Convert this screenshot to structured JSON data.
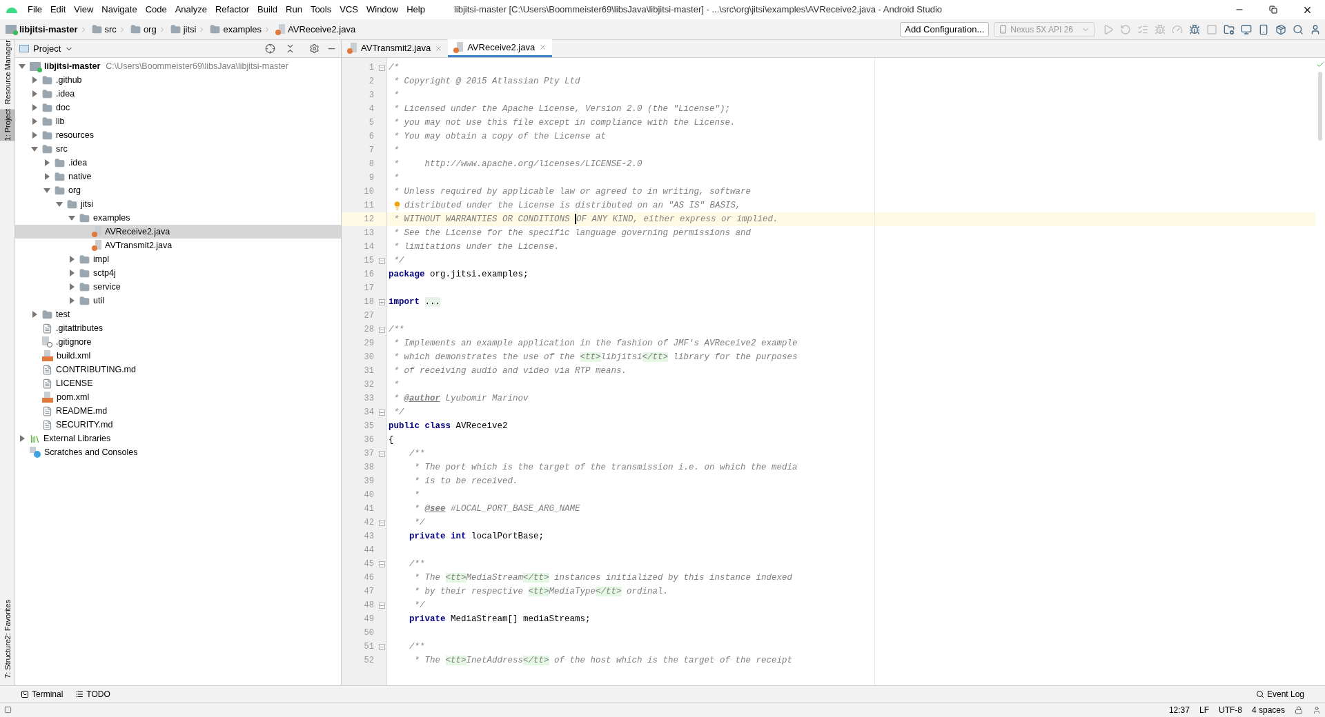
{
  "title_bar": {
    "menus": [
      "File",
      "Edit",
      "View",
      "Navigate",
      "Code",
      "Analyze",
      "Refactor",
      "Build",
      "Run",
      "Tools",
      "VCS",
      "Window",
      "Help"
    ],
    "title": "libjitsi-master [C:\\Users\\Boommeister69\\libsJava\\libjitsi-master] - ...\\src\\org\\jitsi\\examples\\AVReceive2.java - Android Studio"
  },
  "breadcrumbs": [
    {
      "label": "libjitsi-master",
      "kind": "module"
    },
    {
      "label": "src",
      "kind": "folder"
    },
    {
      "label": "org",
      "kind": "folder"
    },
    {
      "label": "jitsi",
      "kind": "folder"
    },
    {
      "label": "examples",
      "kind": "folder"
    },
    {
      "label": "AVReceive2.java",
      "kind": "java"
    }
  ],
  "toolbar": {
    "config_button": "Add Configuration...",
    "device": {
      "label": "Nexus 5X API 26",
      "disabled": true
    },
    "icons": [
      {
        "kind": "run",
        "disabled": true
      },
      {
        "kind": "rerun",
        "disabled": true
      },
      {
        "kind": "coverage",
        "disabled": true
      },
      {
        "kind": "debug",
        "disabled": true
      },
      {
        "kind": "profile",
        "disabled": true
      },
      {
        "kind": "attach",
        "disabled": false
      },
      {
        "kind": "stop",
        "disabled": true
      },
      {
        "kind": "project-structure",
        "disabled": false
      },
      {
        "kind": "sdk",
        "disabled": false
      },
      {
        "kind": "avd",
        "disabled": false
      },
      {
        "kind": "sync",
        "disabled": false
      },
      {
        "kind": "search",
        "disabled": false
      },
      {
        "kind": "account",
        "disabled": false
      }
    ]
  },
  "side_strip": {
    "top": [
      {
        "label": "Resource Manager",
        "selected": false
      },
      {
        "label": "1: Project",
        "selected": true
      }
    ],
    "bottom": [
      {
        "label": "2: Favorites",
        "selected": false
      },
      {
        "label": "7: Structure",
        "selected": false
      }
    ]
  },
  "project_panel": {
    "title": "Project",
    "tree": [
      {
        "label": "libjitsi-master",
        "path": "C:\\Users\\Boommeister69\\libsJava\\libjitsi-master",
        "kind": "module",
        "expanded": true,
        "selected": false,
        "children": [
          {
            "label": ".github",
            "kind": "folder",
            "expanded": false,
            "selected": false
          },
          {
            "label": ".idea",
            "kind": "folder",
            "expanded": false,
            "selected": false
          },
          {
            "label": "doc",
            "kind": "folder",
            "expanded": false,
            "selected": false
          },
          {
            "label": "lib",
            "kind": "folder",
            "expanded": false,
            "selected": false
          },
          {
            "label": "resources",
            "kind": "folder",
            "expanded": false,
            "selected": false
          },
          {
            "label": "src",
            "kind": "folder",
            "expanded": true,
            "selected": false,
            "children": [
              {
                "label": ".idea",
                "kind": "folder",
                "expanded": false,
                "selected": false
              },
              {
                "label": "native",
                "kind": "folder",
                "expanded": false,
                "selected": false
              },
              {
                "label": "org",
                "kind": "folder",
                "expanded": true,
                "selected": false,
                "children": [
                  {
                    "label": "jitsi",
                    "kind": "folder",
                    "expanded": true,
                    "selected": false,
                    "children": [
                      {
                        "label": "examples",
                        "kind": "folder",
                        "expanded": true,
                        "selected": false,
                        "children": [
                          {
                            "label": "AVReceive2.java",
                            "kind": "java",
                            "selected": true
                          },
                          {
                            "label": "AVTransmit2.java",
                            "kind": "java",
                            "selected": false
                          }
                        ]
                      },
                      {
                        "label": "impl",
                        "kind": "folder",
                        "expanded": false,
                        "selected": false
                      },
                      {
                        "label": "sctp4j",
                        "kind": "folder",
                        "expanded": false,
                        "selected": false
                      },
                      {
                        "label": "service",
                        "kind": "folder",
                        "expanded": false,
                        "selected": false
                      },
                      {
                        "label": "util",
                        "kind": "folder",
                        "expanded": false,
                        "selected": false
                      }
                    ]
                  }
                ]
              }
            ]
          },
          {
            "label": "test",
            "kind": "folder",
            "expanded": false,
            "selected": false
          },
          {
            "label": ".gitattributes",
            "kind": "text",
            "selected": false
          },
          {
            "label": ".gitignore",
            "kind": "ignore",
            "selected": false
          },
          {
            "label": "build.xml",
            "kind": "xml",
            "selected": false
          },
          {
            "label": "CONTRIBUTING.md",
            "kind": "text",
            "selected": false
          },
          {
            "label": "LICENSE",
            "kind": "text",
            "selected": false
          },
          {
            "label": "pom.xml",
            "kind": "xml",
            "selected": false
          },
          {
            "label": "README.md",
            "kind": "text",
            "selected": false
          },
          {
            "label": "SECURITY.md",
            "kind": "text",
            "selected": false
          }
        ]
      },
      {
        "label": "External Libraries",
        "kind": "libraries",
        "expanded": false,
        "selected": false
      },
      {
        "label": "Scratches and Consoles",
        "kind": "scratches",
        "selected": false
      }
    ]
  },
  "editor": {
    "tabs": [
      {
        "label": "AVTransmit2.java",
        "selected": false
      },
      {
        "label": "AVReceive2.java",
        "selected": true
      }
    ],
    "lines": [
      {
        "number": "1",
        "fold_start": true,
        "segments": [
          {
            "kind": "comment",
            "text": "/*"
          }
        ]
      },
      {
        "number": "2",
        "segments": [
          {
            "kind": "comment",
            "text": " * Copyright @ 2015 Atlassian Pty Ltd"
          }
        ]
      },
      {
        "number": "3",
        "segments": [
          {
            "kind": "comment",
            "text": " *"
          }
        ]
      },
      {
        "number": "4",
        "segments": [
          {
            "kind": "comment",
            "text": " * Licensed under the Apache License, Version 2.0 (the \"License\");"
          }
        ]
      },
      {
        "number": "5",
        "segments": [
          {
            "kind": "comment",
            "text": " * you may not use this file except in compliance with the License."
          }
        ]
      },
      {
        "number": "6",
        "segments": [
          {
            "kind": "comment",
            "text": " * You may obtain a copy of the License at"
          }
        ]
      },
      {
        "number": "7",
        "segments": [
          {
            "kind": "comment",
            "text": " *"
          }
        ]
      },
      {
        "number": "8",
        "segments": [
          {
            "kind": "comment",
            "text": " *     http://www.apache.org/licenses/LICENSE-2.0"
          }
        ]
      },
      {
        "number": "9",
        "segments": [
          {
            "kind": "comment",
            "text": " *"
          }
        ]
      },
      {
        "number": "10",
        "segments": [
          {
            "kind": "comment",
            "text": " * Unless required by applicable law or agreed to in writing, software"
          }
        ]
      },
      {
        "number": "11",
        "bulb": true,
        "segments": [
          {
            "kind": "comment",
            "text": "distributed under the License is distributed on an \"AS IS\" BASIS,"
          }
        ]
      },
      {
        "number": "12",
        "current": true,
        "segments": [
          {
            "kind": "comment",
            "text": " * WITHOUT WARRANTIES OR CONDITIONS "
          },
          {
            "kind": "caret"
          },
          {
            "kind": "comment",
            "text": "OF ANY KIND, either express or implied."
          }
        ]
      },
      {
        "number": "13",
        "segments": [
          {
            "kind": "comment",
            "text": " * See the License for the specific language governing permissions and"
          }
        ]
      },
      {
        "number": "14",
        "segments": [
          {
            "kind": "comment",
            "text": " * limitations under the License."
          }
        ]
      },
      {
        "number": "15",
        "fold_end": true,
        "segments": [
          {
            "kind": "comment",
            "text": " */"
          }
        ]
      },
      {
        "number": "16",
        "segments": [
          {
            "kind": "keyword",
            "text": "package"
          },
          {
            "kind": "plain",
            "text": " org.jitsi.examples;"
          }
        ]
      },
      {
        "number": "17"
      },
      {
        "number": "18",
        "folded": true,
        "segments": [
          {
            "kind": "keyword",
            "text": "import"
          },
          {
            "kind": "folded",
            "text": "..."
          }
        ]
      },
      {
        "number": "27"
      },
      {
        "number": "28",
        "fold_start": true,
        "segments": [
          {
            "kind": "comment",
            "text": "/**"
          }
        ]
      },
      {
        "number": "29",
        "segments": [
          {
            "kind": "comment",
            "text": " * Implements an example application in the fashion of JMF's AVReceive2 example"
          }
        ]
      },
      {
        "number": "30",
        "segments": [
          {
            "kind": "comment",
            "text": " * which demonstrates the use of the "
          },
          {
            "kind": "tag",
            "text": "<tt>"
          },
          {
            "kind": "comment",
            "text": "libjitsi"
          },
          {
            "kind": "tag",
            "text": "</tt>"
          },
          {
            "kind": "comment",
            "text": " library for the purposes"
          }
        ]
      },
      {
        "number": "31",
        "segments": [
          {
            "kind": "comment",
            "text": " * of receiving audio and video via RTP means."
          }
        ]
      },
      {
        "number": "32",
        "segments": [
          {
            "kind": "comment",
            "text": " *"
          }
        ]
      },
      {
        "number": "33",
        "segments": [
          {
            "kind": "comment",
            "text": " * "
          },
          {
            "kind": "doctag",
            "text": "@author"
          },
          {
            "kind": "comment",
            "text": " Lyubomir Marinov"
          }
        ]
      },
      {
        "number": "34",
        "fold_end": true,
        "segments": [
          {
            "kind": "comment",
            "text": " */"
          }
        ]
      },
      {
        "number": "35",
        "segments": [
          {
            "kind": "keyword",
            "text": "public class"
          },
          {
            "kind": "plain",
            "text": " AVReceive2"
          }
        ]
      },
      {
        "number": "36",
        "segments": [
          {
            "kind": "plain",
            "text": "{"
          }
        ]
      },
      {
        "number": "37",
        "fold_start": true,
        "segments": [
          {
            "kind": "comment",
            "text": "    /**"
          }
        ]
      },
      {
        "number": "38",
        "segments": [
          {
            "kind": "comment",
            "text": "     * The port which is the target of the transmission i.e. on which the media"
          }
        ]
      },
      {
        "number": "39",
        "segments": [
          {
            "kind": "comment",
            "text": "     * is to be received."
          }
        ]
      },
      {
        "number": "40",
        "segments": [
          {
            "kind": "comment",
            "text": "     *"
          }
        ]
      },
      {
        "number": "41",
        "segments": [
          {
            "kind": "comment",
            "text": "     * "
          },
          {
            "kind": "doctag",
            "text": "@see"
          },
          {
            "kind": "comment",
            "text": " #LOCAL_PORT_BASE_ARG_NAME"
          }
        ]
      },
      {
        "number": "42",
        "fold_end": true,
        "segments": [
          {
            "kind": "comment",
            "text": "     */"
          }
        ]
      },
      {
        "number": "43",
        "segments": [
          {
            "kind": "keyword",
            "text": "    private int"
          },
          {
            "kind": "plain",
            "text": " localPortBase;"
          }
        ]
      },
      {
        "number": "44"
      },
      {
        "number": "45",
        "fold_start": true,
        "segments": [
          {
            "kind": "comment",
            "text": "    /**"
          }
        ]
      },
      {
        "number": "46",
        "segments": [
          {
            "kind": "comment",
            "text": "     * The "
          },
          {
            "kind": "tag",
            "text": "<tt>"
          },
          {
            "kind": "comment",
            "text": "MediaStream"
          },
          {
            "kind": "tag",
            "text": "</tt>"
          },
          {
            "kind": "comment",
            "text": " instances initialized by this instance indexed"
          }
        ]
      },
      {
        "number": "47",
        "segments": [
          {
            "kind": "comment",
            "text": "     * by their respective "
          },
          {
            "kind": "tag",
            "text": "<tt>"
          },
          {
            "kind": "comment",
            "text": "MediaType"
          },
          {
            "kind": "tag",
            "text": "</tt>"
          },
          {
            "kind": "comment",
            "text": " ordinal."
          }
        ]
      },
      {
        "number": "48",
        "fold_end": true,
        "segments": [
          {
            "kind": "comment",
            "text": "     */"
          }
        ]
      },
      {
        "number": "49",
        "segments": [
          {
            "kind": "keyword",
            "text": "    private"
          },
          {
            "kind": "plain",
            "text": " MediaStream[] mediaStreams;"
          }
        ]
      },
      {
        "number": "50"
      },
      {
        "number": "51",
        "fold_start": true,
        "segments": [
          {
            "kind": "comment",
            "text": "    /**"
          }
        ]
      },
      {
        "number": "52",
        "segments": [
          {
            "kind": "comment",
            "text": "     * The "
          },
          {
            "kind": "tag",
            "text": "<tt>"
          },
          {
            "kind": "comment",
            "text": "InetAddress"
          },
          {
            "kind": "tag",
            "text": "</tt>"
          },
          {
            "kind": "comment",
            "text": " of the host which is the target of the receipt"
          }
        ]
      }
    ]
  },
  "bottom_tabs": [
    {
      "label": "Terminal",
      "kind": "terminal"
    },
    {
      "label": "TODO",
      "kind": "todo"
    }
  ],
  "event_log": "Event Log",
  "status_bar": {
    "items": [
      "12:37",
      "LF",
      "UTF-8",
      "4 spaces"
    ]
  }
}
